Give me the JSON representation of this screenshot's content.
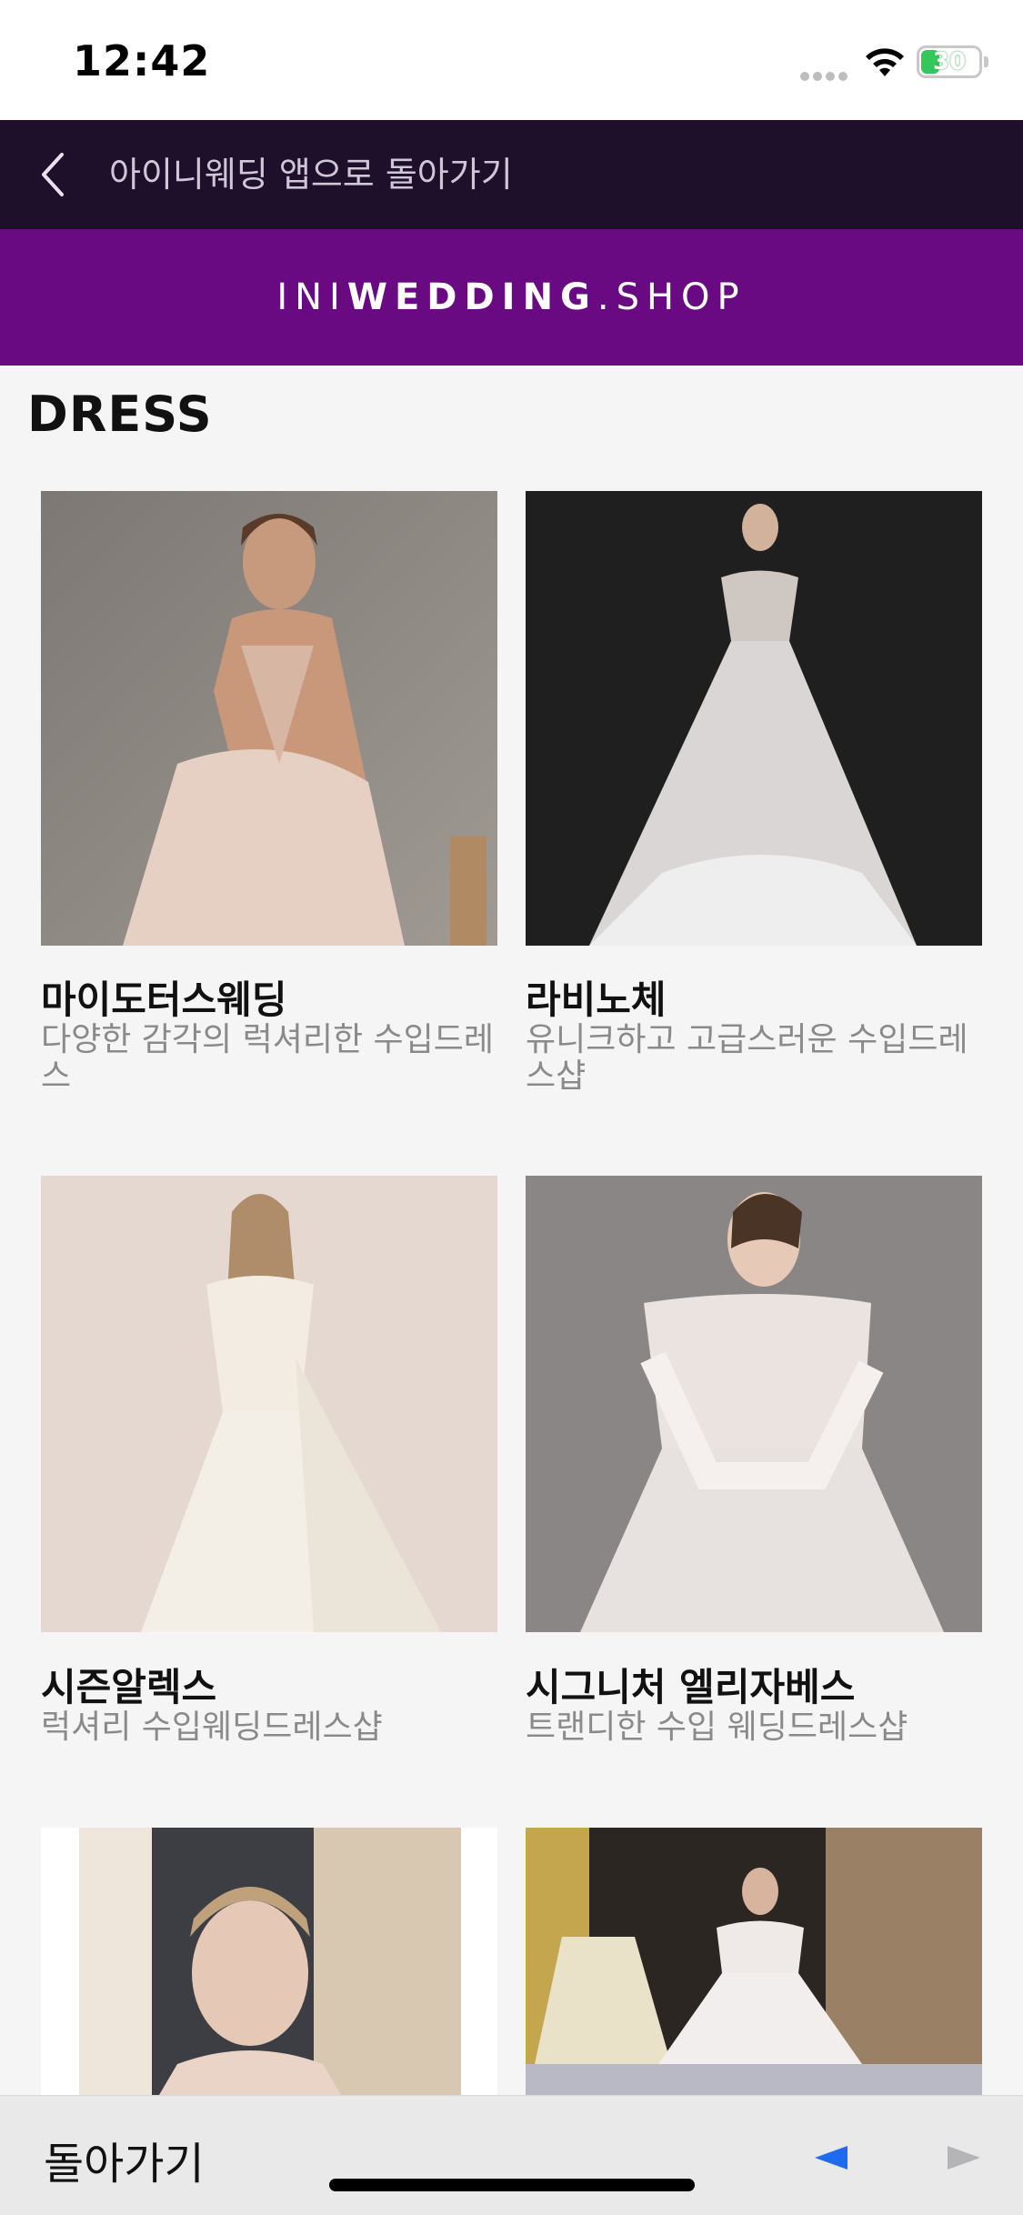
{
  "status": {
    "time": "12:42",
    "battery": "30"
  },
  "nav": {
    "back_label": "아이니웨딩 앱으로 돌아가기"
  },
  "brand": {
    "part1": "INI",
    "part2": "WEDDING",
    "part3": ".SHOP",
    "color": "#6a0a82"
  },
  "section": {
    "title": "DRESS"
  },
  "cards": [
    {
      "name": "마이도터스웨딩",
      "desc": "다양한 감각의 럭셔리한 수입드레스"
    },
    {
      "name": "라비노체",
      "desc": "유니크하고 고급스러운 수입드레스샵"
    },
    {
      "name": "시즌알렉스",
      "desc": "럭셔리 수입웨딩드레스샵"
    },
    {
      "name": "시그니처 엘리자베스",
      "desc": "트랜디한 수입 웨딩드레스샵"
    },
    {
      "name": "",
      "desc": ""
    },
    {
      "name": "",
      "desc": ""
    }
  ],
  "bottom": {
    "back_label": "돌아가기"
  },
  "colors": {
    "nav_bg": "#1e0f2a",
    "accent_arrow": "#1e6bf0"
  }
}
